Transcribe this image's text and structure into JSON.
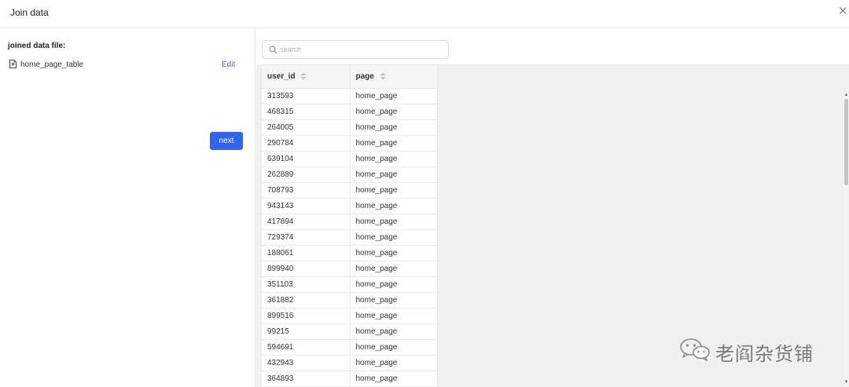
{
  "dialog": {
    "title": "Join data",
    "close_icon": "close-icon"
  },
  "left_panel": {
    "joined_label": "joined data file:",
    "file": {
      "icon": "file-icon",
      "name": "home_page_table",
      "edit_label": "Edit"
    },
    "next_label": "next"
  },
  "search": {
    "placeholder": "search",
    "value": ""
  },
  "table": {
    "columns": [
      "user_id",
      "page"
    ],
    "rows": [
      [
        "313593",
        "home_page"
      ],
      [
        "468315",
        "home_page"
      ],
      [
        "264005",
        "home_page"
      ],
      [
        "290784",
        "home_page"
      ],
      [
        "639104",
        "home_page"
      ],
      [
        "262889",
        "home_page"
      ],
      [
        "708793",
        "home_page"
      ],
      [
        "943143",
        "home_page"
      ],
      [
        "417894",
        "home_page"
      ],
      [
        "729374",
        "home_page"
      ],
      [
        "188061",
        "home_page"
      ],
      [
        "899940",
        "home_page"
      ],
      [
        "351103",
        "home_page"
      ],
      [
        "361882",
        "home_page"
      ],
      [
        "899516",
        "home_page"
      ],
      [
        "99215",
        "home_page"
      ],
      [
        "594691",
        "home_page"
      ],
      [
        "432943",
        "home_page"
      ],
      [
        "364893",
        "home_page"
      ]
    ]
  },
  "watermark": {
    "text": "老阎杂货铺",
    "icon": "wechat-icon"
  },
  "colors": {
    "primary": "#3264ed",
    "link": "#3a6ee8",
    "table_background": "#f0f0f0"
  }
}
